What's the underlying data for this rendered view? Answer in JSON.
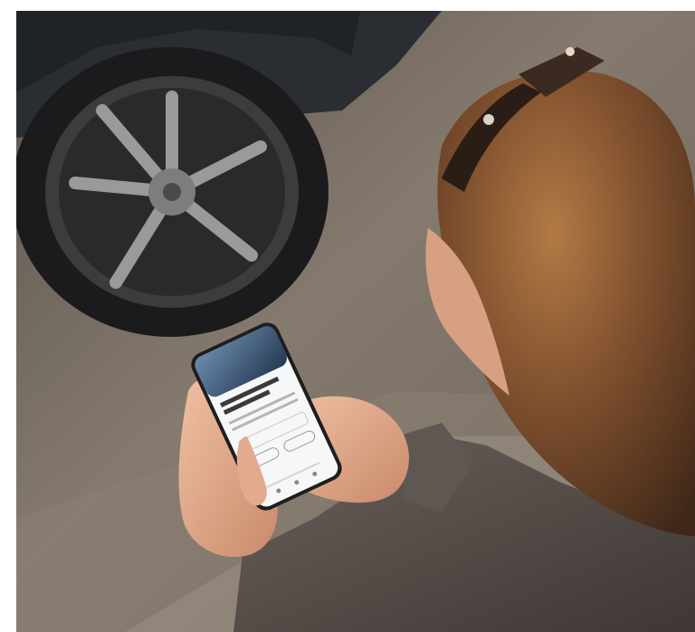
{
  "photo": {
    "subject": "person-using-smartphone-beside-car",
    "colors": {
      "asphalt": "#6f675e",
      "asphalt_light": "#9c9184",
      "car_body": "#26282c",
      "tire": "#1c1c1e",
      "rim": "#8f8f92",
      "hair": "#6a4229",
      "hair_light": "#a9703f",
      "skin": "#e0a98a",
      "coat": "#544a45",
      "phone_body": "#e8e6e6",
      "phone_screen": "#f6f7f9",
      "screen_banner": "#3d5a7a"
    }
  }
}
